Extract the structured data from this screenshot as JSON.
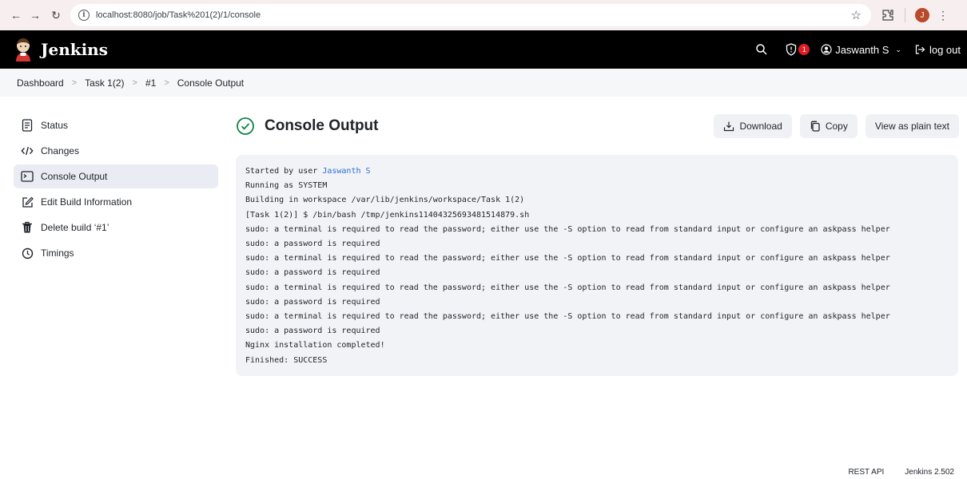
{
  "browser": {
    "url": "localhost:8080/job/Task%201(2)/1/console",
    "profile_initial": "J"
  },
  "header": {
    "brand": "Jenkins",
    "security_badge_count": "1",
    "user_name": "Jaswanth S",
    "logout_label": "log out"
  },
  "breadcrumbs": [
    "Dashboard",
    "Task 1(2)",
    "#1",
    "Console Output"
  ],
  "sidebar": {
    "items": [
      {
        "label": "Status",
        "icon": "document-icon"
      },
      {
        "label": "Changes",
        "icon": "code-icon"
      },
      {
        "label": "Console Output",
        "icon": "terminal-icon",
        "active": true
      },
      {
        "label": "Edit Build Information",
        "icon": "edit-icon"
      },
      {
        "label": "Delete build ‘#1’",
        "icon": "trash-icon"
      },
      {
        "label": "Timings",
        "icon": "clock-icon"
      }
    ]
  },
  "main": {
    "title": "Console Output",
    "actions": {
      "download": "Download",
      "copy": "Copy",
      "plain_text": "View as plain text"
    },
    "console": {
      "started_prefix": "Started by user ",
      "started_user": "Jaswanth S",
      "lines": [
        "Running as SYSTEM",
        "Building in workspace /var/lib/jenkins/workspace/Task 1(2)",
        "[Task 1(2)] $ /bin/bash /tmp/jenkins11404325693481514879.sh",
        "sudo: a terminal is required to read the password; either use the -S option to read from standard input or configure an askpass helper",
        "sudo: a password is required",
        "sudo: a terminal is required to read the password; either use the -S option to read from standard input or configure an askpass helper",
        "sudo: a password is required",
        "sudo: a terminal is required to read the password; either use the -S option to read from standard input or configure an askpass helper",
        "sudo: a password is required",
        "sudo: a terminal is required to read the password; either use the -S option to read from standard input or configure an askpass helper",
        "sudo: a password is required",
        "Nginx installation completed!",
        "Finished: SUCCESS"
      ]
    }
  },
  "footer": {
    "rest_api": "REST API",
    "version": "Jenkins 2.502"
  },
  "colors": {
    "success": "#138347",
    "link": "#2c6fd1",
    "badge": "#e01b24"
  }
}
